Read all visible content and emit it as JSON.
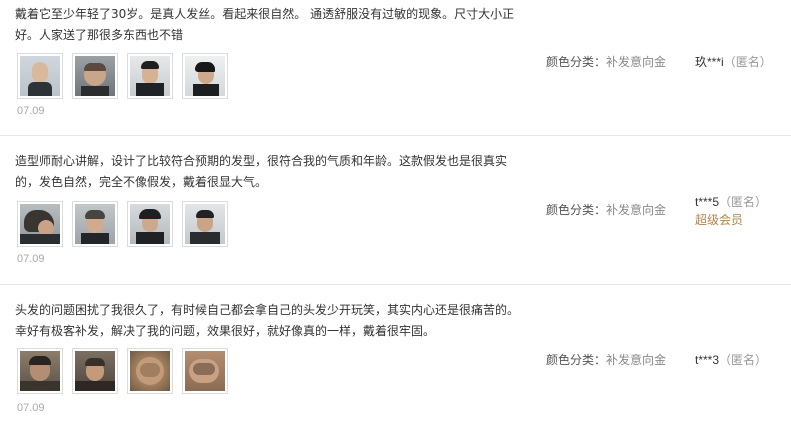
{
  "reviews": [
    {
      "text": "戴着它至少年轻了30岁。是真人发丝。看起来很自然。 通透舒服没有过敏的现象。尺寸大小正好。人家送了那很多东西也不错",
      "date": "07.09",
      "sku_label": "颜色分类：",
      "sku_value": "补发意向金",
      "user_name": "玖***i",
      "user_anon": "（匿名）",
      "badge": ""
    },
    {
      "text": "造型师耐心讲解，设计了比较符合预期的发型，很符合我的气质和年龄。这款假发也是很真实的，发色自然，完全不像假发，戴着很显大气。",
      "date": "07.09",
      "sku_label": "颜色分类：",
      "sku_value": "补发意向金",
      "user_name": "t***5",
      "user_anon": "（匿名）",
      "badge": "超级会员"
    },
    {
      "text": "头发的问题困扰了我很久了，有时候自己都会拿自己的头发少开玩笑，其实内心还是很痛苦的。幸好有极客补发，解决了我的问题，效果很好，就好像真的一样，戴着很牢固。",
      "date": "07.09",
      "sku_label": "颜色分类：",
      "sku_value": "补发意向金",
      "user_name": "t***3",
      "user_anon": "（匿名）",
      "badge": ""
    }
  ],
  "colors": {
    "vip_badge": "#b3834d",
    "date": "#a8a8a8",
    "divider": "#e8e8e8"
  }
}
